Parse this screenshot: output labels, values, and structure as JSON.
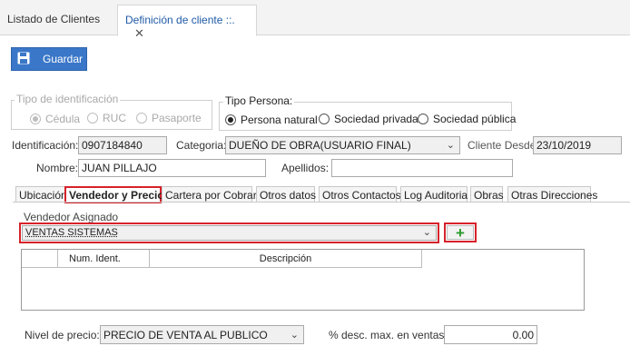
{
  "doc_tabs": [
    {
      "label": "Listado de Clientes",
      "active": false
    },
    {
      "label": "Definición de cliente ::.",
      "active": true
    }
  ],
  "toolbar": {
    "save_label": "Guardar"
  },
  "tipo_identificacion": {
    "legend": "Tipo de identificación",
    "options": [
      "Cédula",
      "RUC",
      "Pasaporte"
    ],
    "selected": "Cédula"
  },
  "tipo_persona": {
    "legend": "Tipo Persona:",
    "options": [
      "Persona natural",
      "Sociedad privada",
      "Sociedad pública"
    ],
    "selected": "Persona natural"
  },
  "form": {
    "identificacion_label": "Identificación:",
    "identificacion_value": "0907184840",
    "categoria_label": "Categoria:",
    "categoria_value": "DUEÑO DE OBRA(USUARIO FINAL)",
    "cliente_desde_label": "Cliente Desde:",
    "cliente_desde_value": "23/10/2019",
    "nombre_label": "Nombre:",
    "nombre_value": "JUAN PILLAJO",
    "apellidos_label": "Apellidos:",
    "apellidos_value": ""
  },
  "sub_tabs": [
    "Ubicación",
    "Vendedor y Precios",
    "Cartera por Cobrar",
    "Otros datos",
    "Otros Contactos",
    "Log Auditoria",
    "Obras",
    "Otras Direcciones"
  ],
  "active_sub_tab": "Vendedor y Precios",
  "vendedor": {
    "label": "Vendedor Asignado",
    "value": "VENTAS SISTEMAS"
  },
  "grid": {
    "columns": [
      "",
      "Num. Ident.",
      "Descripción"
    ]
  },
  "precio": {
    "nivel_label": "Nivel de precio:",
    "nivel_value": "PRECIO DE VENTA AL PUBLICO",
    "desc_label": "% desc. max. en ventas:",
    "desc_value": "0.00"
  },
  "icons": {
    "save": "floppy-disk-icon",
    "add": "plus-icon",
    "close": "close-icon",
    "dropdown": "chevron-down-icon"
  },
  "colors": {
    "accent": "#3a77c8",
    "highlight": "#d6222a",
    "add_green": "#2a9a2a"
  }
}
